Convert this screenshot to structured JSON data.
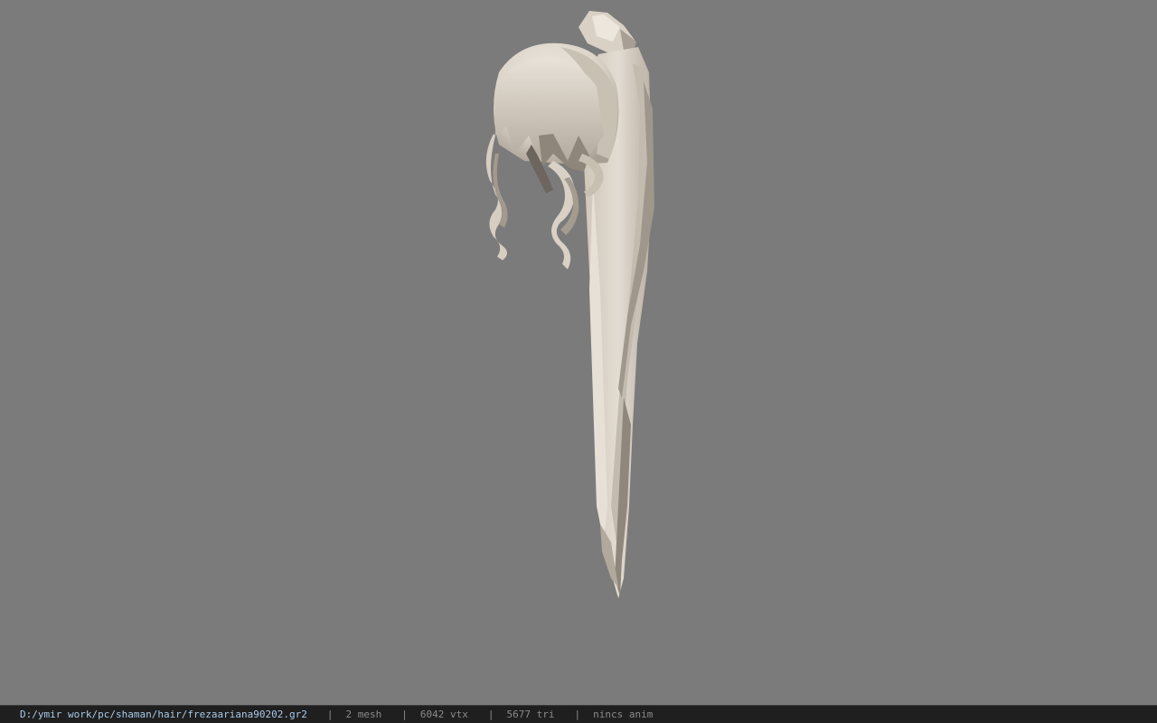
{
  "viewer": {
    "background_color": "#7b7b7b",
    "model_colors": {
      "hair_base": "#d8cfc2",
      "hair_light": "#ece6dd",
      "hair_shadow": "#9d958a",
      "hair_dark": "#6d665f"
    }
  },
  "status_bar": {
    "file_path": "D:/ymir work/pc/shaman/hair/frezaariana90202.gr2",
    "separator": "|",
    "mesh_count": "2 mesh",
    "vertex_count": "6042 vtx",
    "triangle_count": "5677 tri",
    "animation_status": "nincs anim"
  }
}
